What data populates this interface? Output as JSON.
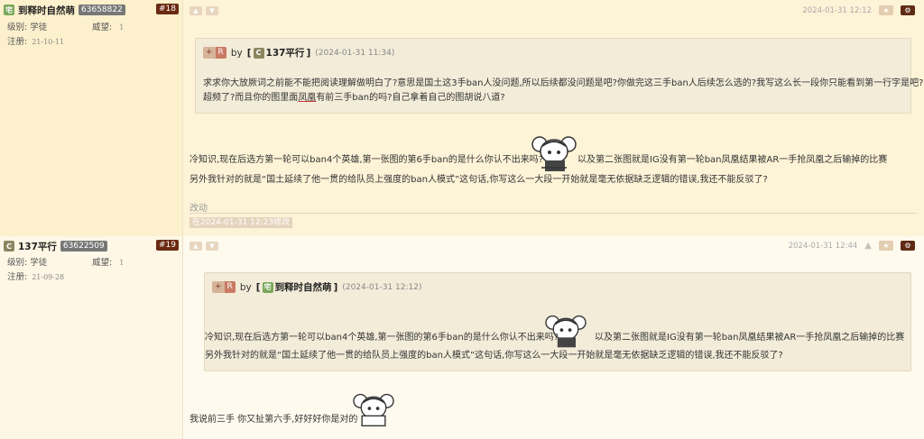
{
  "posts": [
    {
      "user": {
        "name": "到释时自然萌",
        "uid": "63658822",
        "avatar_char": "宅",
        "avatar_color": "#7aa85a"
      },
      "floor": "#18",
      "level_label": "级别:",
      "level": "学徒",
      "prestige_label": "威望:",
      "prestige": "1",
      "reg_label": "注册:",
      "reg_date": "21-10-11",
      "time": "2024-01-31 12:12",
      "quote": {
        "by": "by",
        "name": "137平行",
        "avatar_char": "C",
        "time": "(2024-01-31 11:34)",
        "line1": "求求你大放厥词之前能不能把阅读理解做明白了?意思是国土这3手ban人没问题,所以后续都没问题是吧?你做完这三手ban人后续怎么选的?我写这么长一段你只能看到第一行字是吧?cpu",
        "line2a": "超频了?而且你的图里面",
        "line2u": "凤凰",
        "line2b": "有前三手ban的吗?自己拿着自己的图胡说八道?"
      },
      "body1a": "冷知识,现在后选方第一轮可以ban4个英雄,第一张图的第6手ban的是什么你认不出来吗?",
      "body1b": "以及第二张图就是IG没有第一轮ban凤凰结果被AR一手抢凤凰之后输掉的比赛",
      "body2": "另外我针对的就是“国土延续了他一贯的给队员上强度的ban人模式”这句话,你写这么一大段一开始就是毫无依据缺乏逻辑的错误,我还不能反驳了?",
      "edit_label": "改动",
      "edit_stamp": "在2024-01-31 12:23修改"
    },
    {
      "user": {
        "name": "137平行",
        "uid": "63622509",
        "avatar_char": "C",
        "avatar_color": "#8c8660"
      },
      "floor": "#19",
      "level_label": "级别:",
      "level": "学徒",
      "prestige_label": "威望:",
      "prestige": "1",
      "reg_label": "注册:",
      "reg_date": "21-09-28",
      "time": "2024-01-31 12:44",
      "quote": {
        "by": "by",
        "name": "到释时自然萌",
        "avatar_char": "宅",
        "time": "(2024-01-31 12:12)",
        "line1a": "冷知识,现在后选方第一轮可以ban4个英雄,第一张图的第6手ban的是什么你认不出来吗?",
        "line1b": "以及第二张图就是IG没有第一轮ban凤凰结果被AR一手抢凤凰之后输掉的比赛",
        "line2": "另外我针对的就是“国土延续了他一贯的给队员上强度的ban人模式”这句话,你写这么一大段一开始就是毫无依据缺乏逻辑的错误,我还不能反驳了?"
      },
      "body1": "我说前三手 你又扯第六手,好好好你是对的"
    }
  ],
  "icons": {
    "like": "thumb-up-icon",
    "dislike": "thumb-down-icon",
    "star": "star-icon",
    "gear": "gear-icon",
    "android": "android-icon"
  },
  "colors": {
    "floor_bg": "#6b2a12",
    "quote_bg": "#f3ecd9",
    "page_bg": "#fdf6e3"
  }
}
